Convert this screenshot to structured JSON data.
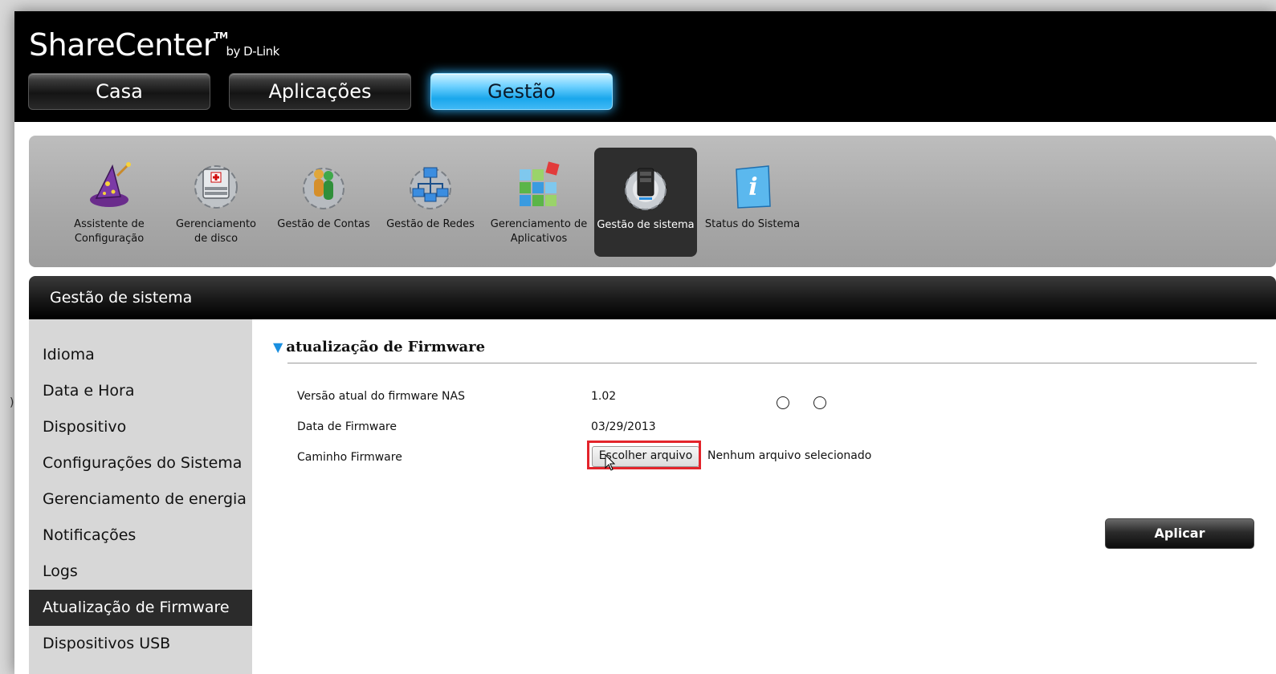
{
  "app": {
    "logo_text": "ShareCenter",
    "logo_tm": "TM",
    "logo_by": "by D-Link"
  },
  "main_tabs": [
    {
      "label": "Casa",
      "active": false
    },
    {
      "label": "Aplicações",
      "active": false
    },
    {
      "label": "Gestão",
      "active": true
    }
  ],
  "icon_bar": [
    {
      "label_line1": "Assistente de",
      "label_line2": "Configuração",
      "icon": "wizard-icon"
    },
    {
      "label_line1": "Gerenciamento",
      "label_line2": "de disco",
      "icon": "disk-management-icon"
    },
    {
      "label_line1": "Gestão de Contas",
      "label_line2": "",
      "icon": "accounts-icon"
    },
    {
      "label_line1": "Gestão de Redes",
      "label_line2": "",
      "icon": "network-icon"
    },
    {
      "label_line1": "Gerenciamento de",
      "label_line2": "Aplicativos",
      "icon": "applications-icon"
    },
    {
      "label_line1": "Gestão de sistema",
      "label_line2": "",
      "icon": "system-management-icon",
      "active": true
    },
    {
      "label_line1": "Status do Sistema",
      "label_line2": "",
      "icon": "info-icon"
    }
  ],
  "panel": {
    "title": "Gestão de sistema"
  },
  "sidebar": {
    "items": [
      {
        "label": "Idioma"
      },
      {
        "label": "Data e Hora"
      },
      {
        "label": "Dispositivo"
      },
      {
        "label": "Configurações do Sistema"
      },
      {
        "label": "Gerenciamento de energia"
      },
      {
        "label": "Notificações"
      },
      {
        "label": "Logs"
      },
      {
        "label": "Atualização de Firmware",
        "active": true
      },
      {
        "label": "Dispositivos USB"
      }
    ]
  },
  "firmware": {
    "section_title": "atualização de Firmware",
    "version_label": "Versão atual do firmware NAS",
    "version_value": "1.02",
    "date_label": "Data de Firmware",
    "date_value": "03/29/2013",
    "path_label": "Caminho Firmware",
    "choose_file_button": "Escolher arquivo",
    "no_file_text": "Nenhum arquivo selecionado",
    "apply_button": "Aplicar"
  },
  "colors": {
    "active_tab": "#1aa7ec",
    "highlight_box": "#e3242b",
    "section_triangle": "#1a8fe0"
  }
}
